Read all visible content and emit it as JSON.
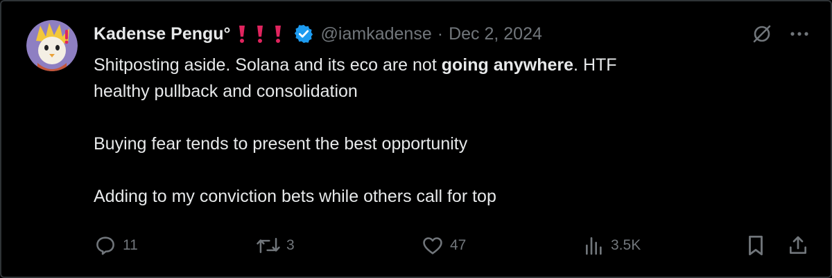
{
  "author": {
    "name": "Kadense Pengu°",
    "handle": "@iamkadense",
    "separator": "·",
    "date": "Dec 2, 2024",
    "verified": true,
    "badge_color": "#1d9bf0",
    "bang_color": "#e0245e"
  },
  "post": {
    "line1_pre": "Shitposting aside.  Solana and its eco are not ",
    "line1_bold": "going anywhere",
    "line1_post": ".  HTF",
    "line2": "healthy pullback and consolidation",
    "line3": "Buying fear tends to present the best opportunity",
    "line4": "Adding to my conviction bets while others call for top"
  },
  "actions": {
    "replies": "11",
    "reposts": "3",
    "likes": "47",
    "views": "3.5K"
  },
  "icons": {
    "top_right": [
      "grok-icon",
      "more-icon"
    ],
    "actions": [
      "reply-icon",
      "repost-icon",
      "like-icon",
      "views-icon",
      "bookmark-icon",
      "share-icon"
    ]
  }
}
